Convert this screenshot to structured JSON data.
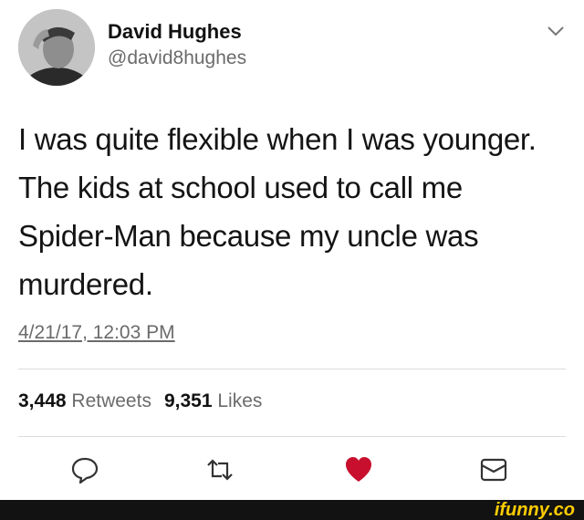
{
  "author": {
    "display_name": "David Hughes",
    "handle": "@david8hughes"
  },
  "tweet": {
    "lines": [
      "I was quite flexible when I was younger.",
      "The kids at school used to call me",
      "Spider-Man because my uncle was",
      "murdered."
    ],
    "timestamp": "4/21/17, 12:03 PM"
  },
  "stats": {
    "retweets_count": "3,448",
    "retweets_label": "Retweets",
    "likes_count": "9,351",
    "likes_label": "Likes"
  },
  "icons": {
    "menu": "chevron-down-icon",
    "reply": "reply-icon",
    "retweet": "retweet-icon",
    "like": "heart-icon",
    "message": "envelope-icon"
  },
  "colors": {
    "like_active": "#c8102e",
    "secondary_text": "#6b6b6b",
    "watermark": "#ffcc00"
  },
  "watermark": "ifunny.co"
}
